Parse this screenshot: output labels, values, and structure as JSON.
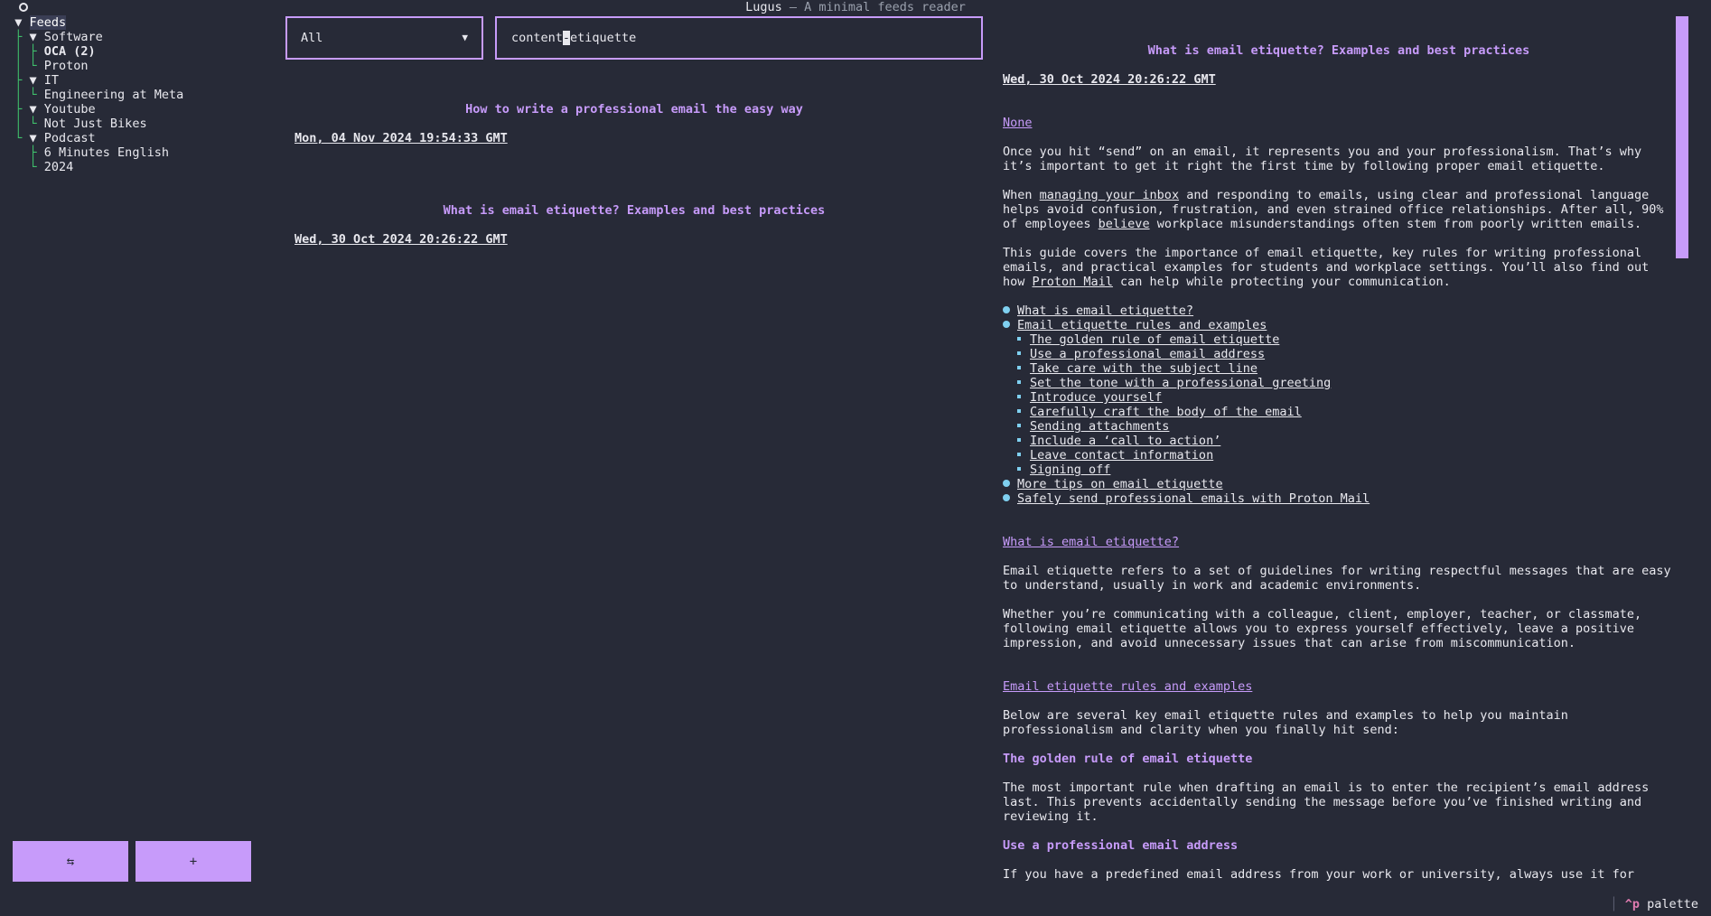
{
  "app": {
    "name": "Lugus",
    "separator": "—",
    "tagline": "A minimal feeds reader"
  },
  "tree": {
    "root": "Feeds",
    "groups": [
      {
        "name": "Software",
        "items": [
          "OCA (2)",
          "Proton"
        ]
      },
      {
        "name": "IT",
        "items": [
          "Engineering at Meta"
        ]
      },
      {
        "name": "Youtube",
        "items": [
          "Not Just Bikes"
        ]
      },
      {
        "name": "Podcast",
        "items": [
          "6 Minutes English",
          "2024"
        ]
      }
    ]
  },
  "sidebar_buttons": {
    "refresh": "⇆",
    "add": "+"
  },
  "filter": {
    "selected": "All",
    "arrow": "▼"
  },
  "search": {
    "before_cursor": "content",
    "cursor": "-",
    "after_cursor": "etiquette"
  },
  "items": [
    {
      "title": "How to write a professional email the easy way",
      "date": "Mon, 04 Nov 2024 19:54:33 GMT"
    },
    {
      "title": "What is email etiquette? Examples and best practices",
      "date": "Wed, 30 Oct 2024 20:26:22 GMT"
    }
  ],
  "article": {
    "title": "What is email etiquette? Examples and best practices",
    "date": "Wed, 30 Oct 2024 20:26:22 GMT",
    "author": "None",
    "p1": "Once you hit “send” on an email, it represents you and your professionalism. That’s why it’s important to get it right the first time by following proper email etiquette.",
    "p2_a": "When ",
    "p2_link": "managing your inbox",
    "p2_b": " and responding to emails, using clear and professional language helps avoid confusion, frustration, and even strained office relationships. After all, 90% of employees ",
    "p2_link2": "believe",
    "p2_c": " workplace misunderstandings often stem from poorly written emails.",
    "p3_a": "This guide covers the importance of email etiquette, key rules for writing professional emails, and practical examples for students and workplace settings. You’ll also find out how ",
    "p3_link": "Proton Mail",
    "p3_b": " can help while protecting your communication.",
    "toc": [
      {
        "label": "What is email etiquette?",
        "sub": []
      },
      {
        "label": "Email etiquette rules and examples",
        "sub": [
          "The golden rule of email etiquette",
          "Use a professional email address",
          "Take care with the subject line",
          "Set the tone with a professional greeting",
          "Introduce yourself",
          "Carefully craft the body of the email",
          "Sending attachments",
          "Include a ‘call to action’",
          "Leave contact information",
          "Signing off"
        ]
      },
      {
        "label": "More tips on email etiquette",
        "sub": []
      },
      {
        "label": "Safely send professional emails with Proton Mail",
        "sub": []
      }
    ],
    "h_what": "What is email etiquette?",
    "p4": "Email etiquette refers to a set of guidelines for writing respectful messages that are easy to understand, usually in work and academic environments.",
    "p5": "Whether you’re communicating with a colleague, client, employer, teacher, or classmate, following email etiquette allows you to express yourself effectively, leave a positive impression, and avoid unnecessary issues that can arise from miscommunication.",
    "h_rules": "Email etiquette rules and examples",
    "p6": "Below are several key email etiquette rules and examples to help you maintain professionalism and clarity when you finally hit send:",
    "h_golden": "The golden rule of email etiquette",
    "p7": "The most important rule when drafting an email is to enter the recipient’s email address last. This prevents accidentally sending the message before you’ve finished writing and reviewing it.",
    "h_address": "Use a professional email address",
    "p8": "If you have a predefined email address from your work or university, always use it for"
  },
  "footer": {
    "key": "^p",
    "label": "palette"
  },
  "colors": {
    "accent": "#c79bfa",
    "background": "#272a37",
    "tree_guide": "#3fbf6b",
    "bullet": "#7fd0f0"
  }
}
